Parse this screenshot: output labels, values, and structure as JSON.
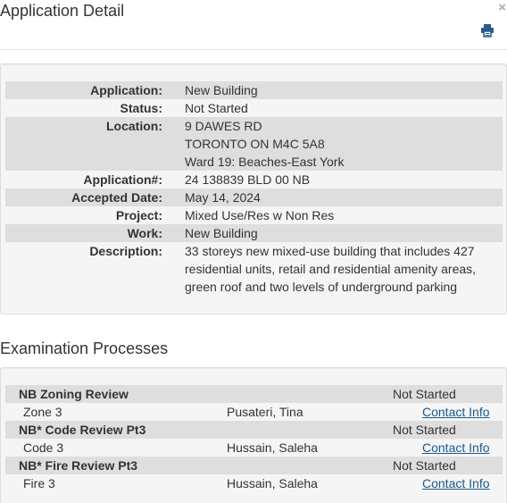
{
  "header": {
    "title": "Application Detail",
    "close_glyph": "×",
    "print_icon": "printer-icon"
  },
  "details": [
    {
      "label": "Application:",
      "lines": [
        "New Building"
      ]
    },
    {
      "label": "Status:",
      "lines": [
        "Not Started"
      ]
    },
    {
      "label": "Location:",
      "lines": [
        "9 DAWES RD",
        "TORONTO ON M4C 5A8",
        "Ward 19: Beaches-East York"
      ]
    },
    {
      "label": "Application#:",
      "lines": [
        "24 138839 BLD 00 NB"
      ]
    },
    {
      "label": "Accepted Date:",
      "lines": [
        "May 14, 2024"
      ]
    },
    {
      "label": "Project:",
      "lines": [
        "Mixed Use/Res w Non Res"
      ]
    },
    {
      "label": "Work:",
      "lines": [
        "New Building"
      ]
    },
    {
      "label": "Description:",
      "lines": [
        "33 storeys new mixed-use building that includes 427",
        "residential units, retail and residential amenity areas,",
        "green roof and two levels of underground parking"
      ]
    }
  ],
  "examination": {
    "title": "Examination Processes",
    "processes": [
      {
        "name": "NB Zoning Review",
        "status": "Not Started",
        "sub": "Zone 3",
        "person": "Pusateri, Tina",
        "contact": "Contact Info"
      },
      {
        "name": "NB* Code Review Pt3",
        "status": "Not Started",
        "sub": "Code 3",
        "person": "Hussain, Saleha",
        "contact": "Contact Info"
      },
      {
        "name": "NB* Fire Review Pt3",
        "status": "Not Started",
        "sub": "Fire 3",
        "person": "Hussain, Saleha",
        "contact": "Contact Info"
      }
    ]
  },
  "colors": {
    "link": "#1a5a8c",
    "print_icon": "#2a5b8a",
    "row_shade": "#dedede",
    "panel_bg": "#f5f5f5"
  }
}
